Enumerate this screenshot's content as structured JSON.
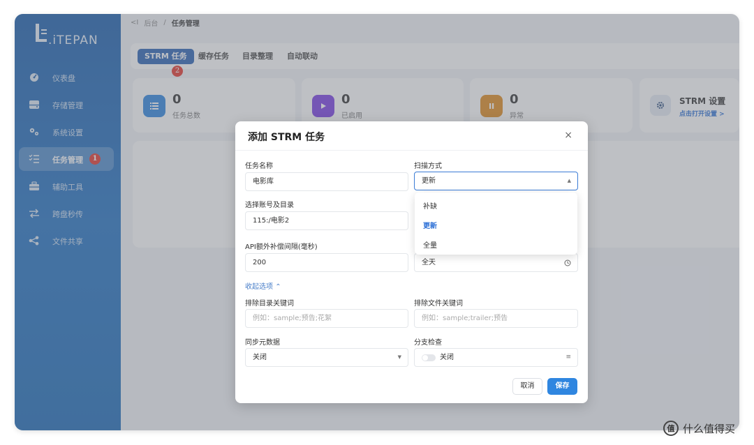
{
  "app": {
    "logo_text": ".iTEPAN"
  },
  "sidebar": {
    "items": [
      {
        "label": "仪表盘",
        "icon": "dashboard-icon"
      },
      {
        "label": "存储管理",
        "icon": "storage-icon"
      },
      {
        "label": "系统设置",
        "icon": "settings-icon"
      },
      {
        "label": "任务管理",
        "icon": "task-list-icon",
        "active": true,
        "badge": "1"
      },
      {
        "label": "辅助工具",
        "icon": "toolbox-icon"
      },
      {
        "label": "跨盘秒传",
        "icon": "transfer-icon"
      },
      {
        "label": "文件共享",
        "icon": "share-icon"
      }
    ]
  },
  "breadcrumb": {
    "back": "<I",
    "parent": "后台",
    "separator": "/",
    "current": "任务管理"
  },
  "tabs": [
    {
      "label": "STRM 任务",
      "active": true,
      "badge": "2"
    },
    {
      "label": "缓存任务"
    },
    {
      "label": "目录整理"
    },
    {
      "label": "自动联动"
    }
  ],
  "stats": [
    {
      "value": "0",
      "label": "任务总数",
      "icon": "list-icon",
      "color": "#2f86e0"
    },
    {
      "value": "0",
      "label": "已启用",
      "icon": "play-icon",
      "color": "#7b3fe4"
    },
    {
      "value": "0",
      "label": "异常",
      "icon": "pause-icon",
      "color": "#e08a1e"
    }
  ],
  "settings_card": {
    "title": "STRM 设置",
    "link": "点击打开设置 >",
    "icon": "gear-icon"
  },
  "modal": {
    "title": "添加 STRM 任务",
    "close": "×",
    "fields": {
      "task_name": {
        "label": "任务名称",
        "value": "电影库"
      },
      "scan_mode": {
        "label": "扫描方式",
        "value": "更新"
      },
      "account_dir": {
        "label": "选择账号及目录",
        "value": "115:/电影2"
      },
      "api_interval": {
        "label": "API额外补偿间隔(毫秒)",
        "value": "200"
      },
      "schedule": {
        "value": "全天"
      },
      "exclude_dir": {
        "label": "排除目录关键词",
        "placeholder": "例如：sample;预告;花絮"
      },
      "exclude_file": {
        "label": "排除文件关键词",
        "placeholder": "例如：sample;trailer;预告"
      },
      "sync_meta": {
        "label": "同步元数据",
        "value": "关闭"
      },
      "branch_check": {
        "label": "分支检查",
        "value": "关闭"
      }
    },
    "collapse_link": "收起选项",
    "buttons": {
      "cancel": "取消",
      "save": "保存"
    }
  },
  "dropdown": {
    "options": [
      "补缺",
      "更新",
      "全量"
    ],
    "selected": "更新"
  },
  "watermark": {
    "icon_text": "值",
    "text": "什么值得买"
  },
  "colors": {
    "sidebar": "#1b5fae",
    "accent": "#2f86e0",
    "badge": "#e5352c"
  }
}
